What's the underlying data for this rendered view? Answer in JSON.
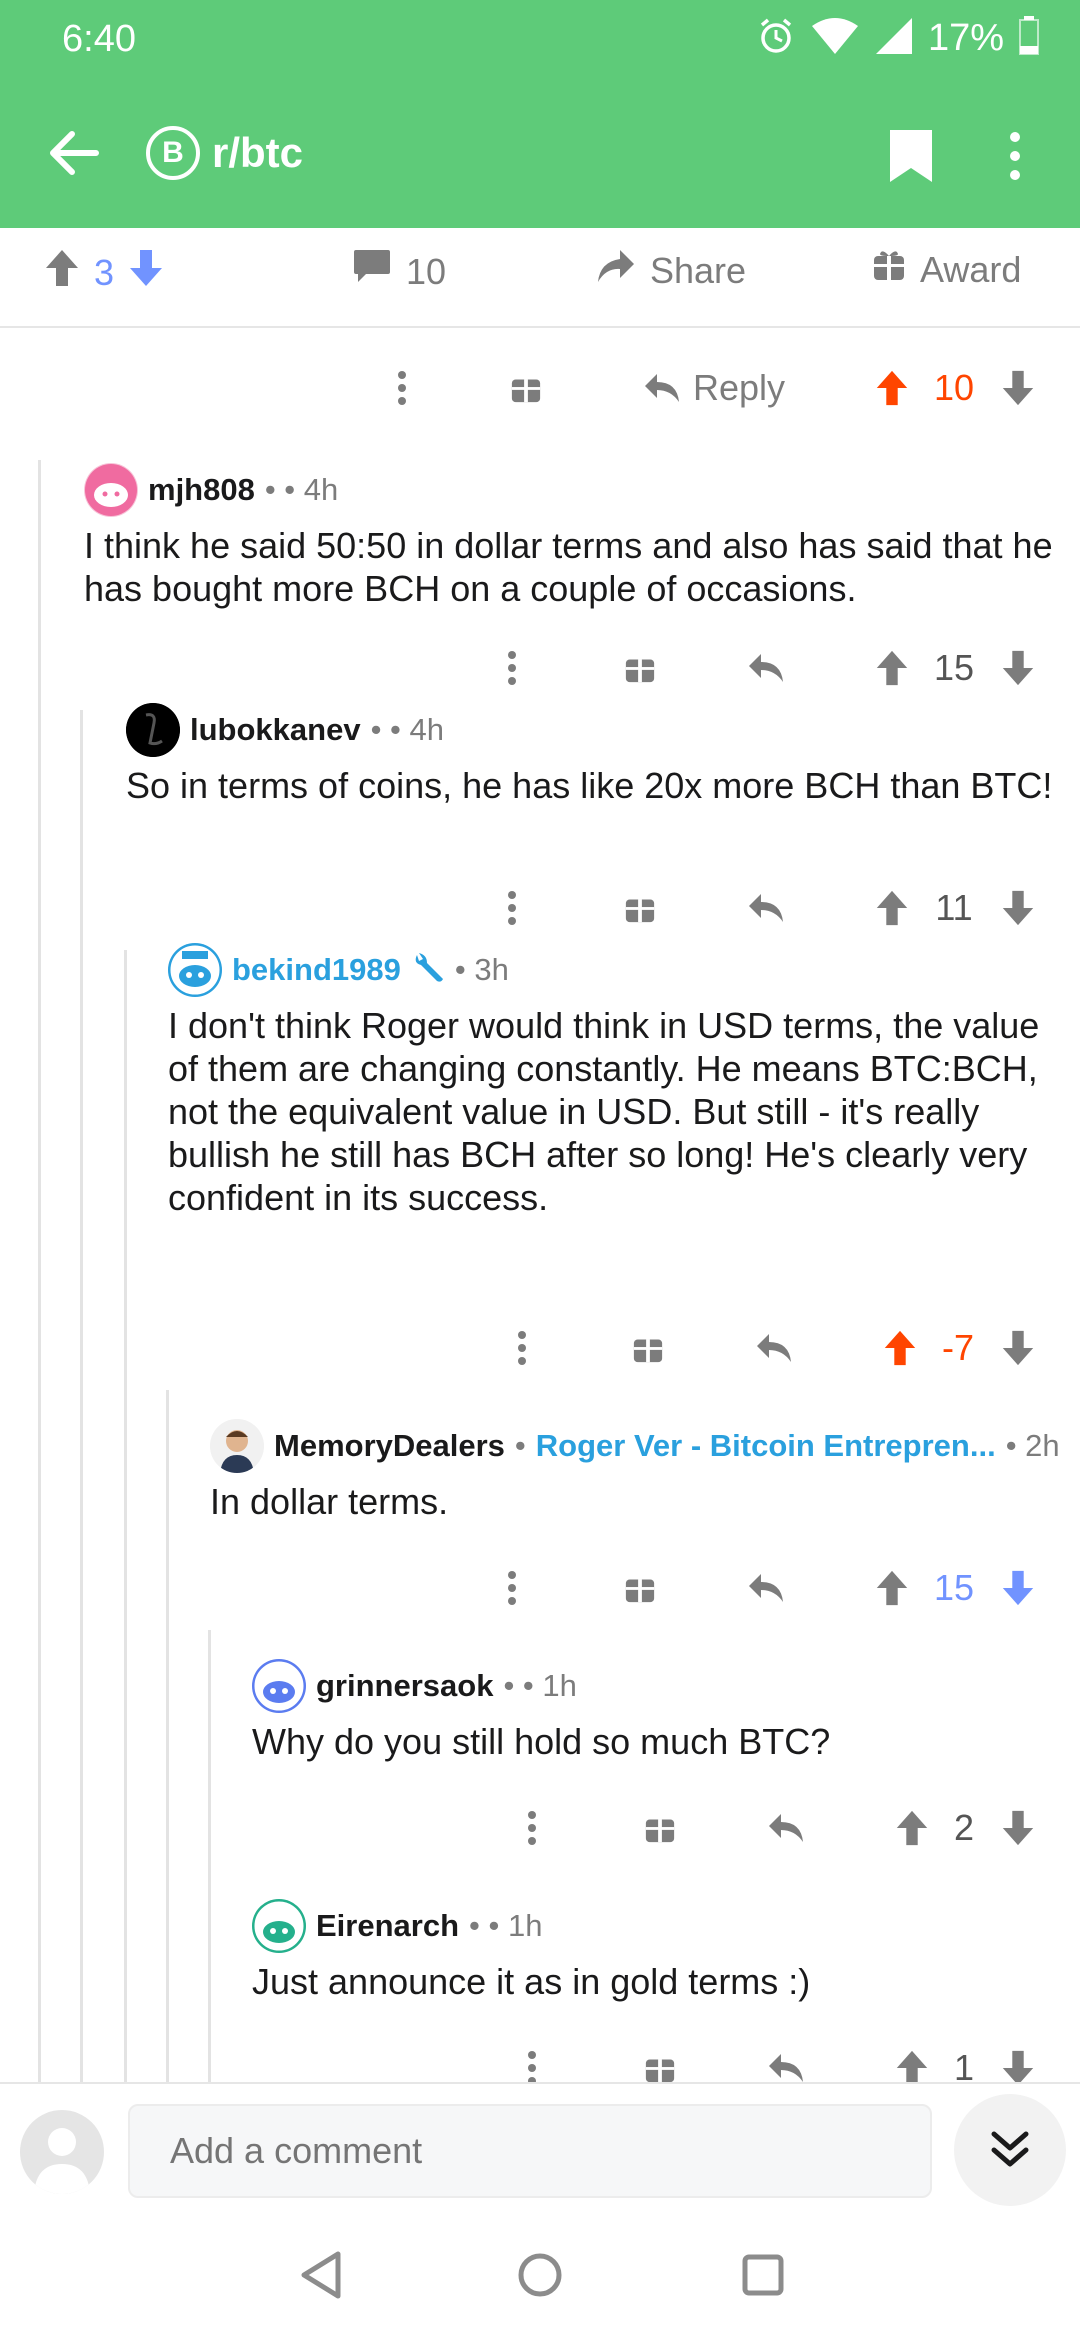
{
  "status": {
    "time": "6:40",
    "battery": "17%"
  },
  "appbar": {
    "subreddit": "r/btc",
    "coin_symbol": "B"
  },
  "post_actions": {
    "vote_count": "3",
    "comment_count": "10",
    "share_label": "Share",
    "award_label": "Award"
  },
  "top_actions": {
    "reply_label": "Reply",
    "score": "10"
  },
  "comments": [
    {
      "user": "mjh808",
      "meta": "• • 4h",
      "body": "I think he said 50:50 in dollar terms and also has said that he has bought more BCH on a couple of occasions.",
      "score": "15"
    },
    {
      "user": "lubokkanev",
      "meta": "• • 4h",
      "body": "So in terms of coins, he has like 20x more BCH than BTC!",
      "score": "11"
    },
    {
      "user": "bekind1989",
      "meta": "• 3h",
      "body": "I don't think Roger would think in USD terms, the value of them are changing constantly. He means BTC:BCH, not the equivalent value in USD. But still - it's really bullish he still has BCH after so long! He's clearly very confident in its success.",
      "score": "-7"
    },
    {
      "user": "MemoryDealers",
      "flair": "Roger Ver - Bitcoin Entrepren...",
      "meta": "• 2h",
      "body": "In dollar terms.",
      "score": "15"
    },
    {
      "user": "grinnersaok",
      "meta": "• • 1h",
      "body": "Why do you still hold so much BTC?",
      "score": "2"
    },
    {
      "user": "Eirenarch",
      "meta": "• • 1h",
      "body": "Just announce it as in gold terms :)",
      "score": "1"
    }
  ],
  "comment_bar": {
    "placeholder": "Add a comment"
  },
  "colors": {
    "brand": "#5ecb79",
    "upvoted": "#ff4500",
    "downvoted": "#7193ff",
    "op": "#2aa0de"
  }
}
